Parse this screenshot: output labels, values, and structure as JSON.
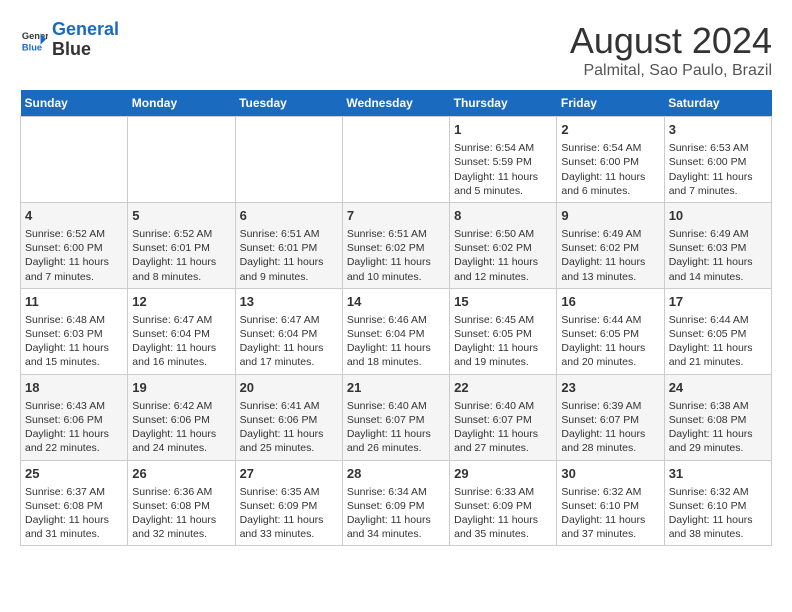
{
  "header": {
    "logo_line1": "General",
    "logo_line2": "Blue",
    "title": "August 2024",
    "subtitle": "Palmital, Sao Paulo, Brazil"
  },
  "days_of_week": [
    "Sunday",
    "Monday",
    "Tuesday",
    "Wednesday",
    "Thursday",
    "Friday",
    "Saturday"
  ],
  "weeks": [
    [
      {
        "day": "",
        "info": ""
      },
      {
        "day": "",
        "info": ""
      },
      {
        "day": "",
        "info": ""
      },
      {
        "day": "",
        "info": ""
      },
      {
        "day": "1",
        "info": "Sunrise: 6:54 AM\nSunset: 5:59 PM\nDaylight: 11 hours and 5 minutes."
      },
      {
        "day": "2",
        "info": "Sunrise: 6:54 AM\nSunset: 6:00 PM\nDaylight: 11 hours and 6 minutes."
      },
      {
        "day": "3",
        "info": "Sunrise: 6:53 AM\nSunset: 6:00 PM\nDaylight: 11 hours and 7 minutes."
      }
    ],
    [
      {
        "day": "4",
        "info": "Sunrise: 6:52 AM\nSunset: 6:00 PM\nDaylight: 11 hours and 7 minutes."
      },
      {
        "day": "5",
        "info": "Sunrise: 6:52 AM\nSunset: 6:01 PM\nDaylight: 11 hours and 8 minutes."
      },
      {
        "day": "6",
        "info": "Sunrise: 6:51 AM\nSunset: 6:01 PM\nDaylight: 11 hours and 9 minutes."
      },
      {
        "day": "7",
        "info": "Sunrise: 6:51 AM\nSunset: 6:02 PM\nDaylight: 11 hours and 10 minutes."
      },
      {
        "day": "8",
        "info": "Sunrise: 6:50 AM\nSunset: 6:02 PM\nDaylight: 11 hours and 12 minutes."
      },
      {
        "day": "9",
        "info": "Sunrise: 6:49 AM\nSunset: 6:02 PM\nDaylight: 11 hours and 13 minutes."
      },
      {
        "day": "10",
        "info": "Sunrise: 6:49 AM\nSunset: 6:03 PM\nDaylight: 11 hours and 14 minutes."
      }
    ],
    [
      {
        "day": "11",
        "info": "Sunrise: 6:48 AM\nSunset: 6:03 PM\nDaylight: 11 hours and 15 minutes."
      },
      {
        "day": "12",
        "info": "Sunrise: 6:47 AM\nSunset: 6:04 PM\nDaylight: 11 hours and 16 minutes."
      },
      {
        "day": "13",
        "info": "Sunrise: 6:47 AM\nSunset: 6:04 PM\nDaylight: 11 hours and 17 minutes."
      },
      {
        "day": "14",
        "info": "Sunrise: 6:46 AM\nSunset: 6:04 PM\nDaylight: 11 hours and 18 minutes."
      },
      {
        "day": "15",
        "info": "Sunrise: 6:45 AM\nSunset: 6:05 PM\nDaylight: 11 hours and 19 minutes."
      },
      {
        "day": "16",
        "info": "Sunrise: 6:44 AM\nSunset: 6:05 PM\nDaylight: 11 hours and 20 minutes."
      },
      {
        "day": "17",
        "info": "Sunrise: 6:44 AM\nSunset: 6:05 PM\nDaylight: 11 hours and 21 minutes."
      }
    ],
    [
      {
        "day": "18",
        "info": "Sunrise: 6:43 AM\nSunset: 6:06 PM\nDaylight: 11 hours and 22 minutes."
      },
      {
        "day": "19",
        "info": "Sunrise: 6:42 AM\nSunset: 6:06 PM\nDaylight: 11 hours and 24 minutes."
      },
      {
        "day": "20",
        "info": "Sunrise: 6:41 AM\nSunset: 6:06 PM\nDaylight: 11 hours and 25 minutes."
      },
      {
        "day": "21",
        "info": "Sunrise: 6:40 AM\nSunset: 6:07 PM\nDaylight: 11 hours and 26 minutes."
      },
      {
        "day": "22",
        "info": "Sunrise: 6:40 AM\nSunset: 6:07 PM\nDaylight: 11 hours and 27 minutes."
      },
      {
        "day": "23",
        "info": "Sunrise: 6:39 AM\nSunset: 6:07 PM\nDaylight: 11 hours and 28 minutes."
      },
      {
        "day": "24",
        "info": "Sunrise: 6:38 AM\nSunset: 6:08 PM\nDaylight: 11 hours and 29 minutes."
      }
    ],
    [
      {
        "day": "25",
        "info": "Sunrise: 6:37 AM\nSunset: 6:08 PM\nDaylight: 11 hours and 31 minutes."
      },
      {
        "day": "26",
        "info": "Sunrise: 6:36 AM\nSunset: 6:08 PM\nDaylight: 11 hours and 32 minutes."
      },
      {
        "day": "27",
        "info": "Sunrise: 6:35 AM\nSunset: 6:09 PM\nDaylight: 11 hours and 33 minutes."
      },
      {
        "day": "28",
        "info": "Sunrise: 6:34 AM\nSunset: 6:09 PM\nDaylight: 11 hours and 34 minutes."
      },
      {
        "day": "29",
        "info": "Sunrise: 6:33 AM\nSunset: 6:09 PM\nDaylight: 11 hours and 35 minutes."
      },
      {
        "day": "30",
        "info": "Sunrise: 6:32 AM\nSunset: 6:10 PM\nDaylight: 11 hours and 37 minutes."
      },
      {
        "day": "31",
        "info": "Sunrise: 6:32 AM\nSunset: 6:10 PM\nDaylight: 11 hours and 38 minutes."
      }
    ]
  ]
}
